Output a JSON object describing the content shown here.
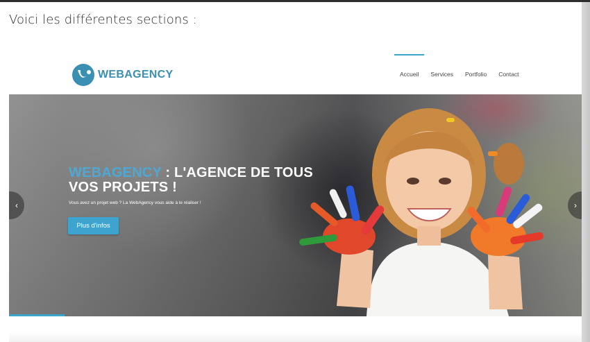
{
  "intro": {
    "text": "Voici les différentes sections :"
  },
  "site": {
    "logo_text": "WEBAGENCY",
    "logo_icon": "swirl-logo-icon",
    "brand_color": "#3b8fb3",
    "accent_color": "#3fa3cf",
    "nav": [
      {
        "label": "Accueil",
        "active": true
      },
      {
        "label": "Services",
        "active": false
      },
      {
        "label": "Portfolio",
        "active": false
      },
      {
        "label": "Contact",
        "active": false
      }
    ],
    "hero": {
      "title_brand": "WEBAGENCY",
      "title_line1_rest": " : L'AGENCE DE TOUS",
      "title_line2": "VOS PROJETS !",
      "subtitle": "Vous avez un projet web ? La WebAgency vous aide à le réaliser !",
      "cta_label": "Plus d'infos",
      "prev_arrow": "‹",
      "next_arrow": "›",
      "image_description_icon": "child-painted-hands-photo"
    }
  }
}
